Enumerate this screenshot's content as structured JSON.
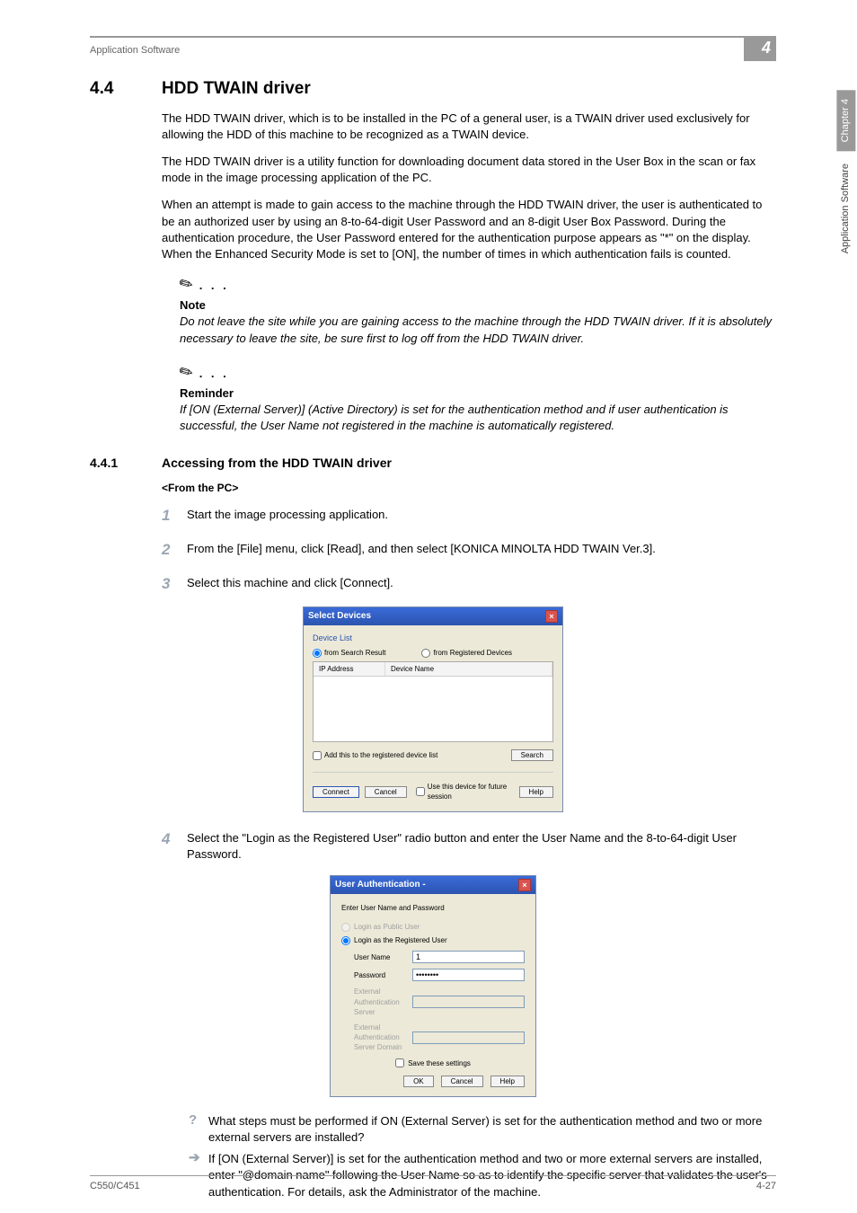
{
  "header": {
    "left": "Application Software",
    "right": "4"
  },
  "side": {
    "chapter": "Chapter 4",
    "section": "Application Software"
  },
  "s1": {
    "num": "4.4",
    "title": "HDD TWAIN driver"
  },
  "p1": "The HDD TWAIN driver, which is to be installed in the PC of a general user, is a TWAIN driver used exclusively for allowing the HDD of this machine to be recognized as a TWAIN device.",
  "p2": "The HDD TWAIN driver is a utility function for downloading document data stored in the User Box in the scan or fax mode in the image processing application of the PC.",
  "p3": "When an attempt is made to gain access to the machine through the HDD TWAIN driver, the user is authenticated to be an authorized user by using an 8-to-64-digit User Password and an 8-digit User Box Password. During the authentication procedure, the User Password entered for the authentication purpose appears as \"*\" on the display. When the Enhanced Security Mode is set to [ON], the number of times in which authentication fails is counted.",
  "note": {
    "title": "Note",
    "body": "Do not leave the site while you are gaining access to the machine through the HDD TWAIN driver. If it is absolutely necessary to leave the site, be sure first to log off from the HDD TWAIN driver."
  },
  "reminder": {
    "title": "Reminder",
    "body": "If [ON (External Server)] (Active Directory) is set for the authentication method and if user authentication is successful, the User Name not registered in the machine is automatically registered."
  },
  "s2": {
    "num": "4.4.1",
    "title": "Accessing from the HDD TWAIN driver"
  },
  "sub": "<From the PC>",
  "steps": {
    "1": "Start the image processing application.",
    "2": "From the [File] menu, click [Read], and then select [KONICA MINOLTA HDD TWAIN Ver.3].",
    "3": "Select this machine and click [Connect].",
    "4": "Select the \"Login as the Registered User\" radio button and enter the User Name and the 8-to-64-digit User Password."
  },
  "dlg1": {
    "title": "Select Devices",
    "group": "Device List",
    "radio1": "from Search Result",
    "radio2": "from Registered Devices",
    "col1": "IP Address",
    "col2": "Device Name",
    "addchk": "Add this to the registered device list",
    "search": "Search",
    "connect": "Connect",
    "cancel": "Cancel",
    "usechk": "Use this device for future session",
    "help": "Help"
  },
  "dlg2": {
    "title": "User Authentication -",
    "prompt": "Enter User Name and Password",
    "opt1": "Login as Public User",
    "opt2": "Login as the Registered User",
    "user_label": "User Name",
    "user_value": "1",
    "pass_label": "Password",
    "pass_value": "••••••••",
    "ext1": "External Authentication Server",
    "ext2": "External Authentication Server Domain",
    "save": "Save these settings",
    "ok": "OK",
    "cancel": "Cancel",
    "help": "Help"
  },
  "qa": {
    "q": "What steps must be performed if ON (External Server) is set for the authentication method and two or more external servers are installed?",
    "a": "If [ON (External Server)] is set for the authentication method and two or more external servers are installed, enter \"@domain name\" following the User Name so as to identify the specific server that validates the user's authentication. For details, ask the Administrator of the machine."
  },
  "footer": {
    "left": "C550/C451",
    "right": "4-27"
  }
}
